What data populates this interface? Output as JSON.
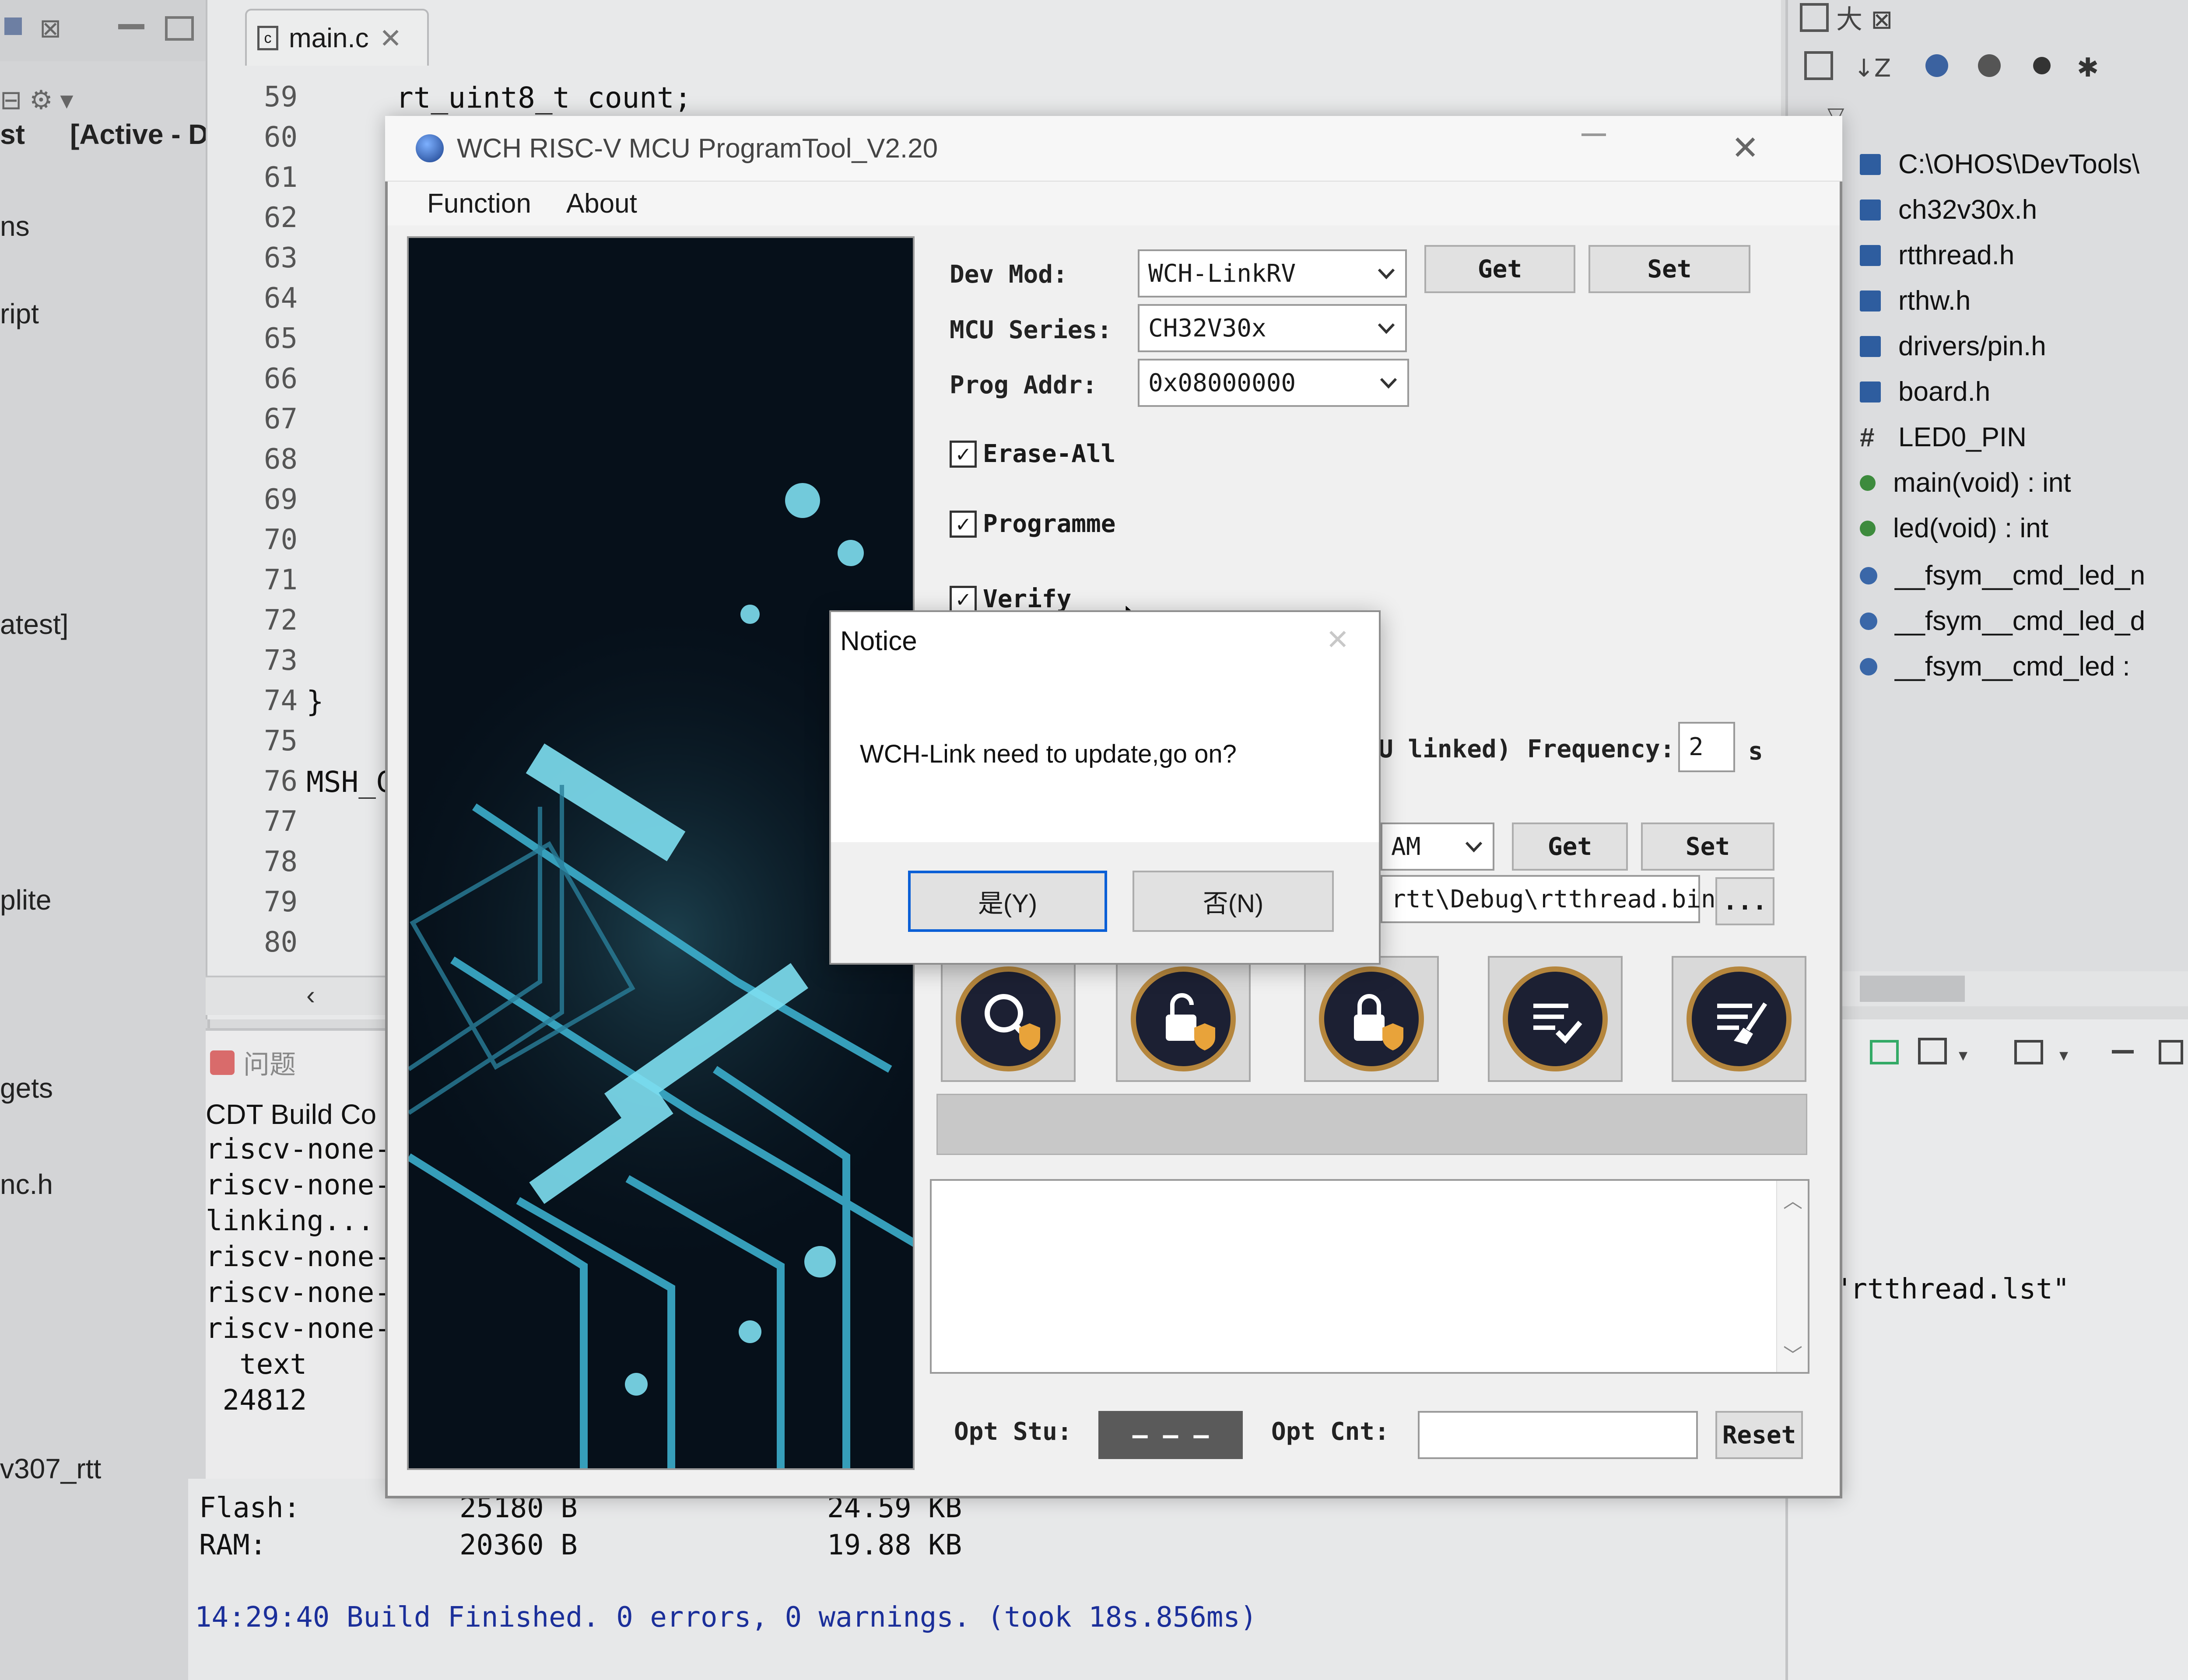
{
  "ide": {
    "left_frags": [
      "st",
      "[Active - D",
      "ns",
      "ript",
      "atest]",
      "plite",
      "gets",
      "nc.h",
      "v307_rtt"
    ],
    "editor_tab": "main.c",
    "line_numbers": [
      "59",
      "60",
      "61",
      "62",
      "63",
      "64",
      "65",
      "66",
      "67",
      "68",
      "69",
      "70",
      "71",
      "72",
      "73",
      "74",
      "75",
      "76",
      "77",
      "78",
      "79",
      "80"
    ],
    "code_lines": {
      "l59": "rt_uint8_t count;",
      "l74": "}",
      "l76": "MSH_C"
    },
    "problems_tab": "问题",
    "console_title": "CDT Build Co",
    "console_lines": [
      "riscv-none-",
      "riscv-none-",
      "linking...",
      "riscv-none-",
      "riscv-none-",
      "riscv-none-",
      "  text",
      " 24812"
    ],
    "summary": {
      "flash_label": "Flash:",
      "flash_bytes": "25180 B",
      "flash_kb": "24.59 KB",
      "ram_label": "RAM:",
      "ram_bytes": "20360 B",
      "ram_kb": "19.88 KB",
      "build_line": "14:29:40 Build Finished. 0 errors, 0 warnings. (took 18s.856ms)"
    },
    "outline_items": [
      {
        "label": "C:\\OHOS\\DevTools\\",
        "icon": "header-icon"
      },
      {
        "label": "ch32v30x.h",
        "icon": "header-icon"
      },
      {
        "label": "rtthread.h",
        "icon": "header-icon"
      },
      {
        "label": "rthw.h",
        "icon": "header-icon"
      },
      {
        "label": "drivers/pin.h",
        "icon": "header-icon"
      },
      {
        "label": "board.h",
        "icon": "header-icon"
      },
      {
        "label": "LED0_PIN",
        "icon": "macro-icon"
      },
      {
        "label": "main(void) : int",
        "icon": "function-icon"
      },
      {
        "label": "led(void) : int",
        "icon": "function-icon"
      },
      {
        "label": "__fsym__cmd_led_n",
        "icon": "variable-icon"
      },
      {
        "label": "__fsym__cmd_led_d",
        "icon": "variable-icon"
      },
      {
        "label": "__fsym__cmd_led :",
        "icon": "variable-icon"
      }
    ],
    "right_console_text": "\"rtthread.lst\""
  },
  "tool": {
    "title": "WCH RISC-V MCU ProgramTool_V2.20",
    "menu": [
      "Function",
      "About"
    ],
    "dev_mod_label": "Dev Mod:",
    "dev_mod_value": "WCH-LinkRV",
    "mcu_series_label": "MCU Series:",
    "mcu_series_value": "CH32V30x",
    "prog_addr_label": "Prog Addr:",
    "prog_addr_value": "0x08000000",
    "get_label": "Get",
    "set_label": "Set",
    "erase_all": "Erase-All",
    "programme": "Programme",
    "verify": "Verify",
    "linked_frag": "U linked)",
    "frequency_label": "Frequency:",
    "frequency_value": "2",
    "frequency_unit": "s",
    "ram_frag": "AM",
    "get2_label": "Get",
    "set2_label": "Set",
    "file_path": "rtt\\Debug\\rtthread.bin",
    "browse_label": "...",
    "opt_stu_label": "Opt Stu:",
    "opt_stu_value": "— — —",
    "opt_cnt_label": "Opt Cnt:",
    "reset_label": "Reset"
  },
  "notice": {
    "title": "Notice",
    "message": "WCH-Link need to update,go on?",
    "yes_label": "是(Y)",
    "no_label": "否(N)"
  },
  "colors": {
    "accent": "#0a5fd6",
    "icon_ring": "#b5863d",
    "icon_fill": "#1c2033",
    "console_blue": "#1b2f9a"
  }
}
